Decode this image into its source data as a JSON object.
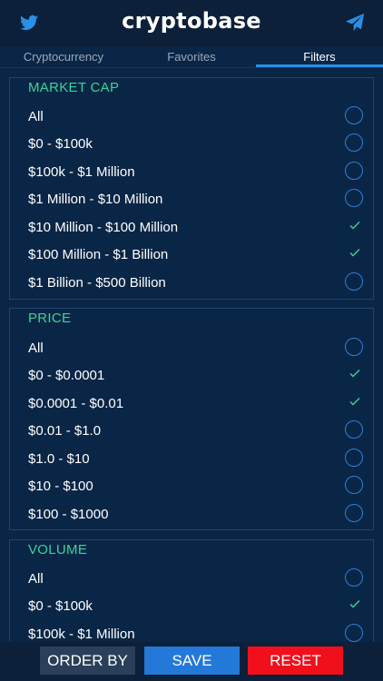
{
  "header": {
    "title": "cryptobase",
    "left_icon": "twitter-icon",
    "right_icon": "send-icon"
  },
  "tabs": [
    {
      "label": "Cryptocurrency",
      "active": false
    },
    {
      "label": "Favorites",
      "active": false
    },
    {
      "label": "Filters",
      "active": true
    }
  ],
  "colors": {
    "accent": "#2a8fe6",
    "section_title": "#3ad39a",
    "check": "#3ad39a",
    "radio": "#2f7fd6",
    "reset": "#f10f1c"
  },
  "sections": [
    {
      "title": "MARKET CAP",
      "options": [
        {
          "label": "All",
          "selected": false
        },
        {
          "label": "$0 - $100k",
          "selected": false
        },
        {
          "label": "$100k - $1 Million",
          "selected": false
        },
        {
          "label": "$1 Million - $10 Million",
          "selected": false
        },
        {
          "label": "$10 Million - $100 Million",
          "selected": true
        },
        {
          "label": "$100 Million - $1 Billion",
          "selected": true
        },
        {
          "label": "$1 Billion - $500 Billion",
          "selected": false
        }
      ]
    },
    {
      "title": "PRICE",
      "options": [
        {
          "label": "All",
          "selected": false
        },
        {
          "label": "$0 - $0.0001",
          "selected": true
        },
        {
          "label": "$0.0001 - $0.01",
          "selected": true
        },
        {
          "label": "$0.01 - $1.0",
          "selected": false
        },
        {
          "label": "$1.0 - $10",
          "selected": false
        },
        {
          "label": "$10 - $100",
          "selected": false
        },
        {
          "label": "$100 - $1000",
          "selected": false
        }
      ]
    },
    {
      "title": "VOLUME",
      "options": [
        {
          "label": "All",
          "selected": false
        },
        {
          "label": "$0 - $100k",
          "selected": true
        },
        {
          "label": "$100k - $1 Million",
          "selected": false
        }
      ]
    }
  ],
  "footer": {
    "order_by_label": "ORDER BY",
    "save_label": "SAVE",
    "reset_label": "RESET"
  }
}
